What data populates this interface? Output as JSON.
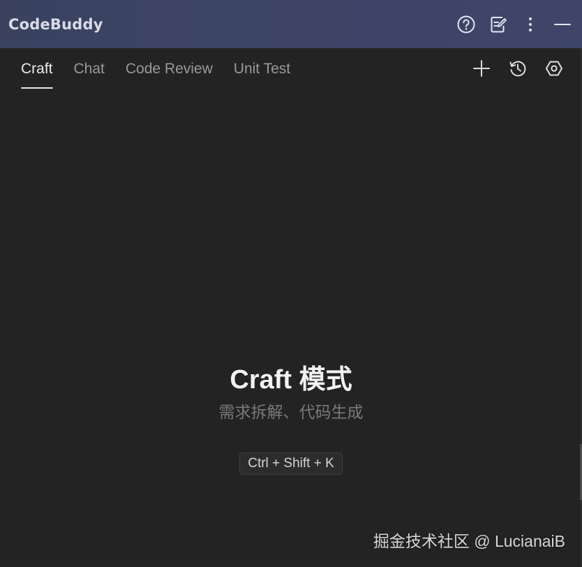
{
  "titlebar": {
    "title": "CodeBuddy",
    "icons": [
      "help-icon",
      "edit-note-icon",
      "more-vertical-icon",
      "minimize-icon"
    ]
  },
  "tabs": [
    {
      "label": "Craft",
      "active": true
    },
    {
      "label": "Chat",
      "active": false
    },
    {
      "label": "Code Review",
      "active": false
    },
    {
      "label": "Unit Test",
      "active": false
    }
  ],
  "tab_actions": [
    "plus-icon",
    "history-icon",
    "settings-icon"
  ],
  "main": {
    "title": "Craft 模式",
    "subtitle": "需求拆解、代码生成",
    "shortcut": "Ctrl + Shift + K"
  },
  "watermark": "掘金技术社区 @ LucianaiB",
  "colors": {
    "titlebar_bg": "#3d4466",
    "panel_bg": "#232323",
    "tab_active": "#ececec",
    "tab_inactive": "#9a9a9a"
  }
}
